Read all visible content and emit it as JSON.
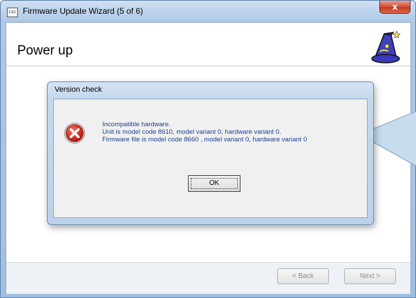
{
  "window": {
    "title": "Firmware Update Wizard (5 of 6)",
    "app_icon_text": "csc",
    "close_glyph": "x"
  },
  "page": {
    "title": "Power up",
    "wizard_icon": "wizard-hat-icon"
  },
  "dialog": {
    "title": "Version check",
    "icon": "error-icon",
    "messages": [
      "Incompatible hardware.",
      "Unit is model code 8610, model variant 0, hardware variant 0.",
      "Firmware file is model code 8660 , model variant 0, hardware variant 0"
    ],
    "ok_label": "OK"
  },
  "footer": {
    "back_label": "< Back",
    "next_label": "Next >"
  },
  "colors": {
    "message_text": "#1a3f8f",
    "error_red": "#c0231f",
    "close_red": "#c43b22"
  }
}
